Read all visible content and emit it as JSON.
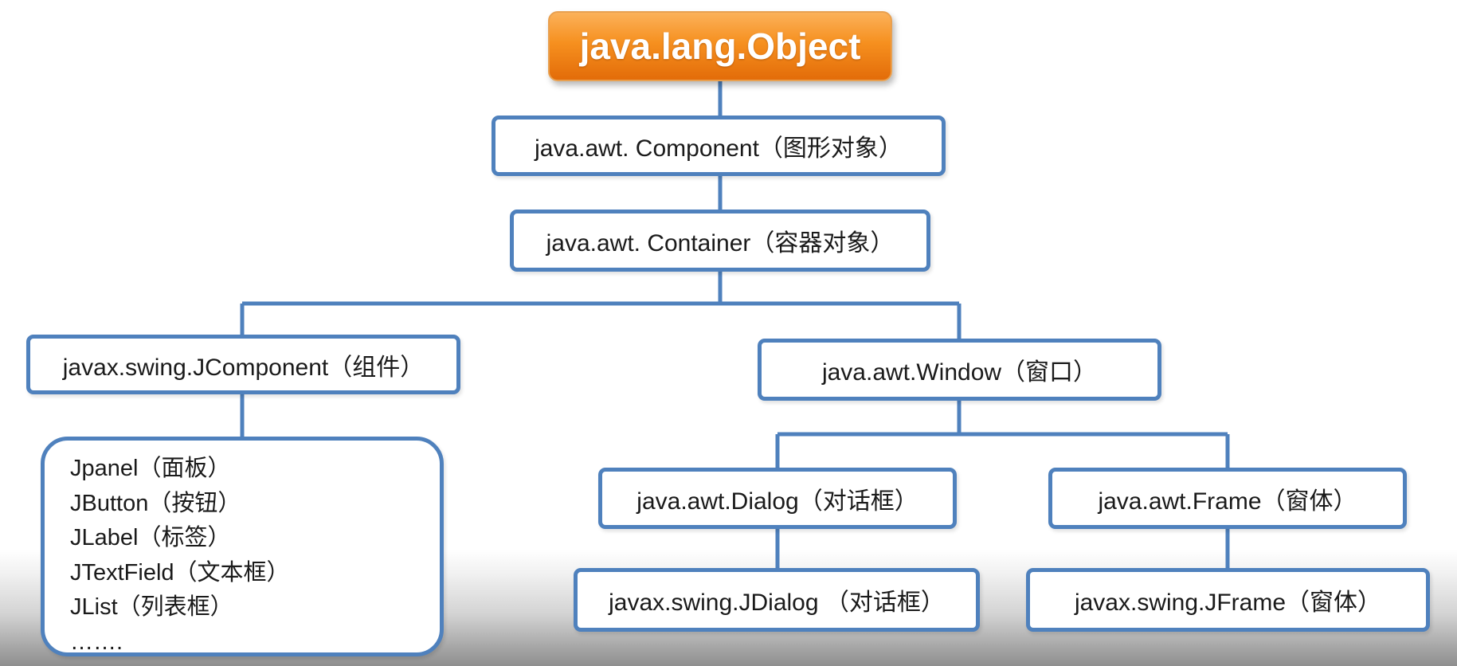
{
  "diagram": {
    "root": {
      "label": "java.lang.Object"
    },
    "nodes": {
      "component": {
        "label": "java.awt. Component（图形对象）"
      },
      "container": {
        "label": "java.awt. Container（容器对象）"
      },
      "jcomponent": {
        "label": "javax.swing.JComponent（组件）"
      },
      "window": {
        "label": "java.awt.Window（窗口）"
      },
      "dialog": {
        "label": "java.awt.Dialog（对话框）"
      },
      "frame": {
        "label": "java.awt.Frame（窗体）"
      },
      "jdialog": {
        "label": "javax.swing.JDialog （对话框）"
      },
      "jframe": {
        "label": "javax.swing.JFrame（窗体）"
      }
    },
    "swing_components": [
      "Jpanel（面板）",
      "JButton（按钮）",
      "JLabel（标签）",
      "JTextField（文本框）",
      "JList（列表框）",
      "……."
    ],
    "colors": {
      "box_border": "#4f81bd",
      "connector": "#4f81bd",
      "root_fill": "#f6901f",
      "root_text": "#ffffff"
    }
  }
}
